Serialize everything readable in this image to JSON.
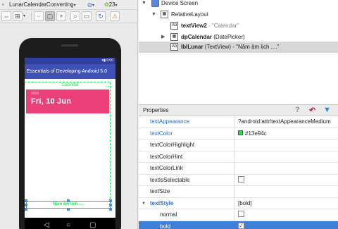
{
  "toolbar": {
    "config_name": "LunarCalendarConverting",
    "api_level": "23",
    "caret": "▾"
  },
  "device": {
    "status_time": "6:00",
    "app_title": "Essentials of Developing Android 5.0",
    "calendar_label": "Calendar",
    "year": "2016",
    "date": "Fri, 10 Jun",
    "lunar_text": "Năm âm lịch ....",
    "colors": {
      "status_bar": "#303f9f",
      "app_bar": "#3f51b5",
      "date_card": "#ec407a",
      "accent": "#13e94c"
    }
  },
  "tree": {
    "root": "Device Screen",
    "layout": "RelativeLayout",
    "children": [
      {
        "name": "textView2",
        "detail": "- \"Calendar\"",
        "icon": "textview-icon"
      },
      {
        "name": "dpCalendar",
        "detail": "(DatePicker)",
        "icon": "datepicker-icon"
      },
      {
        "name": "lblLunar",
        "detail": "(TextView) - \"Năm âm lịch ....\"",
        "icon": "textview-icon"
      }
    ]
  },
  "properties": {
    "title": "Properties",
    "help": "?",
    "rows": [
      {
        "name": "textAppearance",
        "value": "?android:attr/textAppearanceMedium"
      },
      {
        "name": "textColor",
        "value": "#13e94c"
      },
      {
        "name": "textColorHighlight",
        "value": ""
      },
      {
        "name": "textColorHint",
        "value": ""
      },
      {
        "name": "textColorLink",
        "value": ""
      },
      {
        "name": "textIsSelectable",
        "value": ""
      },
      {
        "name": "textSize",
        "value": ""
      },
      {
        "name": "textStyle",
        "value": "[bold]"
      },
      {
        "name": "normal",
        "value": ""
      },
      {
        "name": "bold",
        "value": "✓"
      }
    ]
  }
}
